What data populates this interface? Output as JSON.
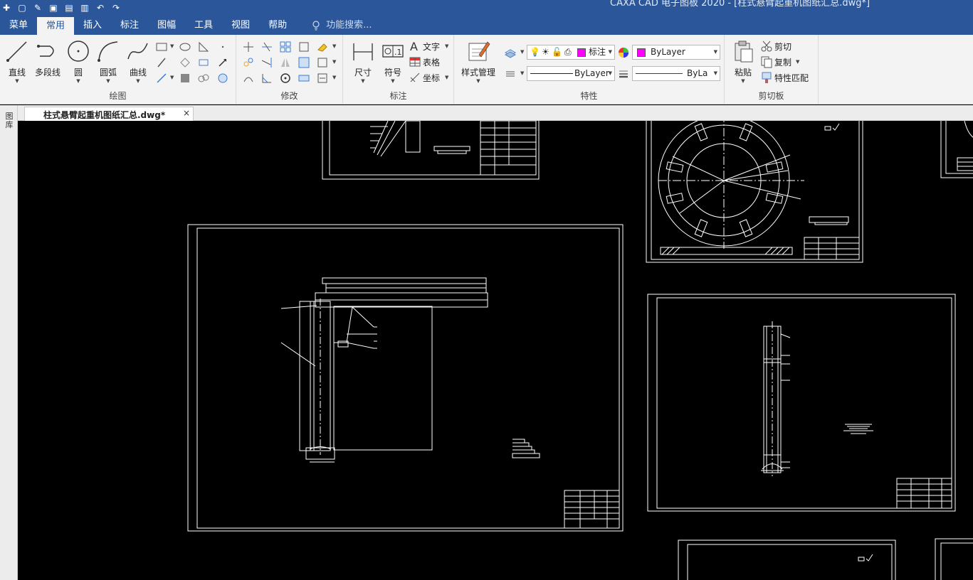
{
  "app": {
    "window_title": "CAXA CAD 电子图板 2020 - [柱式悬臂起重机图纸汇总.dwg*]"
  },
  "quick_access": [
    "new-icon",
    "open-icon",
    "save-icon",
    "saveas-icon",
    "print-icon",
    "undo-icon",
    "redo-icon"
  ],
  "tabs": [
    {
      "label": "菜单",
      "active": false
    },
    {
      "label": "常用",
      "active": true
    },
    {
      "label": "插入",
      "active": false
    },
    {
      "label": "标注",
      "active": false
    },
    {
      "label": "图幅",
      "active": false
    },
    {
      "label": "工具",
      "active": false
    },
    {
      "label": "视图",
      "active": false
    },
    {
      "label": "帮助",
      "active": false
    }
  ],
  "search": {
    "placeholder": "功能搜索..."
  },
  "ribbon": {
    "draw": {
      "label": "绘图",
      "buttons": [
        "直线",
        "多段线",
        "圆",
        "圆弧",
        "曲线"
      ]
    },
    "modify": {
      "label": "修改"
    },
    "annotate": {
      "label": "标注",
      "dimension": "尺寸",
      "symbol": "符号",
      "text": "文字",
      "table": "表格",
      "coordinate": "坐标"
    },
    "properties": {
      "label": "特性",
      "style_manager": "样式管理",
      "layer": "标注",
      "color": "ByLayer",
      "linetype": "ByLayer",
      "lineweight": "ByLaye"
    },
    "clipboard": {
      "label": "剪切板",
      "paste": "粘贴",
      "cut": "剪切",
      "copy": "复制",
      "match": "特性匹配"
    }
  },
  "document_tab": {
    "name": "柱式悬臂起重机图纸汇总.dwg*",
    "close": "×"
  },
  "left_panel": {
    "label": "图库"
  },
  "colors": {
    "titlebar": "#2b579a",
    "ribbon": "#f3f3f3",
    "canvas": "#000000",
    "drawing": "#ffffff",
    "magenta": "#ff00ff",
    "red_line": "#d40000"
  }
}
